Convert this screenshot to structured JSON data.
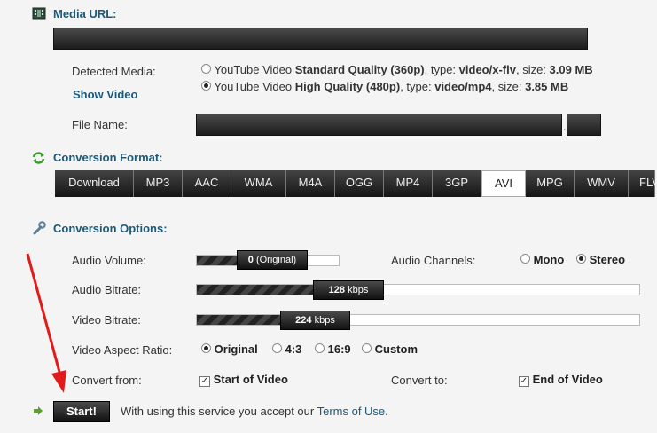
{
  "media_url": {
    "title": "Media URL:",
    "value": ""
  },
  "detected": {
    "label": "Detected Media:",
    "show_video": "Show Video",
    "options": [
      {
        "prefix": "YouTube Video ",
        "quality": "Standard Quality (360p)",
        "type_label": ", type: ",
        "type": "video/x-flv",
        "size_label": ", size: ",
        "size": "3.09 MB",
        "selected": false
      },
      {
        "prefix": "YouTube Video ",
        "quality": "High Quality (480p)",
        "type_label": ", type: ",
        "type": "video/mp4",
        "size_label": ", size: ",
        "size": "3.85 MB",
        "selected": true
      }
    ]
  },
  "file_name": {
    "label": "File Name:",
    "value": "",
    "dot": ".",
    "ext": ""
  },
  "conversion_format": {
    "title": "Conversion Format:",
    "tabs": [
      "Download",
      "MP3",
      "AAC",
      "WMA",
      "M4A",
      "OGG",
      "MP4",
      "3GP",
      "AVI",
      "MPG",
      "WMV",
      "FLV"
    ],
    "active": "AVI"
  },
  "conversion_options": {
    "title": "Conversion Options:",
    "audio_volume": {
      "label": "Audio Volume:",
      "value": "0",
      "suffix": " (Original)",
      "level": 0
    },
    "audio_channels": {
      "label": "Audio Channels:",
      "mono": "Mono",
      "stereo": "Stereo",
      "selected": "Stereo"
    },
    "audio_bitrate": {
      "label": "Audio Bitrate:",
      "value": "128",
      "unit": " kbps",
      "level": 0.27
    },
    "video_bitrate": {
      "label": "Video Bitrate:",
      "value": "224",
      "unit": " kbps",
      "level": 0.18
    },
    "aspect_ratio": {
      "label": "Video Aspect Ratio:",
      "options": [
        "Original",
        "4:3",
        "16:9",
        "Custom"
      ],
      "selected": "Original"
    },
    "convert_from": {
      "label": "Convert from:",
      "checkbox": "Start of Video",
      "checked": true
    },
    "convert_to": {
      "label": "Convert to:",
      "checkbox": "End of Video",
      "checked": true
    }
  },
  "footer": {
    "start": "Start!",
    "notice": "With using this service you accept our ",
    "terms": "Terms of Use",
    "period": "."
  },
  "colors": {
    "accent": "#1c5a7a",
    "annotation_arrow": "#e11b1b"
  }
}
